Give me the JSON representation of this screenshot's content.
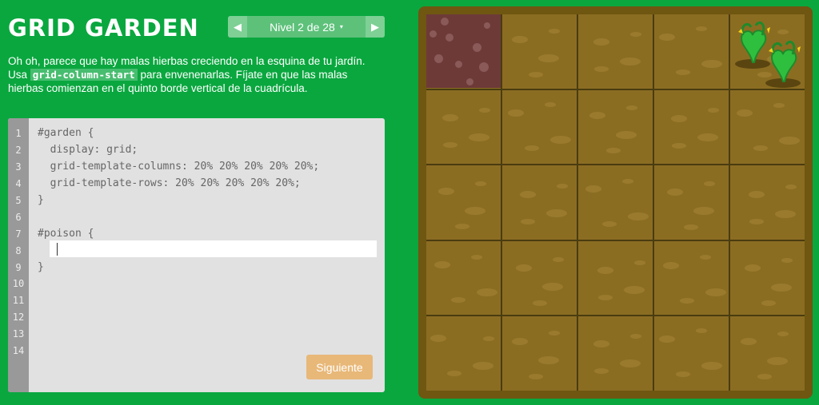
{
  "header": {
    "title": "GRID GARDEN",
    "level_label": "Nivel 2 de 28",
    "prev_arrow": "◀",
    "next_arrow": "▶",
    "caret": "▾"
  },
  "instructions": {
    "part1": "Oh oh, parece que hay malas hierbas creciendo en la esquina de tu jardín. Usa ",
    "code": "grid-column-start",
    "part2": " para envenenarlas. Fíjate en que las malas hierbas comienzan en el quinto borde vertical de la cuadrícula."
  },
  "editor": {
    "line_numbers": [
      "1",
      "2",
      "3",
      "4",
      "5",
      "6",
      "7",
      "8",
      "9",
      "10",
      "11",
      "12",
      "13",
      "14"
    ],
    "lines": [
      "#garden {",
      "  display: grid;",
      "  grid-template-columns: 20% 20% 20% 20% 20%;",
      "  grid-template-rows: 20% 20% 20% 20% 20%;",
      "}",
      "",
      "#poison {",
      "",
      "}"
    ],
    "input_value": "",
    "next_button_label": "Siguiente"
  },
  "colors": {
    "background": "#0aa73f",
    "editor_bg": "#e1e1e1",
    "soil": "#8b6d22",
    "poison": "#6d3a38",
    "button": "#e8b878"
  }
}
